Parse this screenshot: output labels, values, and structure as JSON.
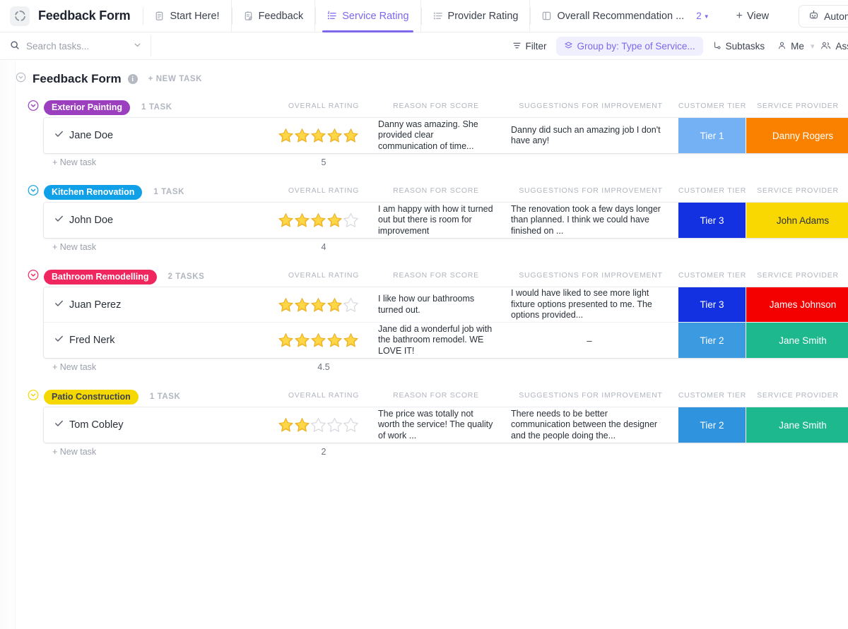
{
  "window": {
    "app_title": "Feedback Form",
    "logo_icon": "clickup-spinner-icon"
  },
  "tabs": [
    {
      "label": "Start Here!",
      "icon": "doc-icon",
      "active": false
    },
    {
      "label": "Feedback",
      "icon": "doc-edit-icon",
      "active": false
    },
    {
      "label": "Service Rating",
      "icon": "list-icon",
      "active": true
    },
    {
      "label": "Provider Rating",
      "icon": "list-icon",
      "active": false
    },
    {
      "label": "Overall Recommendation ...",
      "icon": "board-icon",
      "active": false
    }
  ],
  "tab_overflow_count": "2",
  "add_view_label": "View",
  "automate_label": "Automate",
  "search": {
    "placeholder": "Search tasks...",
    "value": "",
    "icon": "search-icon"
  },
  "toolbar": {
    "filter_label": "Filter",
    "filter_icon": "filter-icon",
    "groupby_label": "Group by: Type of Service...",
    "groupby_icon": "layers-icon",
    "subtasks_label": "Subtasks",
    "subtasks_icon": "subtask-icon",
    "me_label": "Me",
    "me_icon": "person-icon",
    "assignees_label": "Assign",
    "assignees_icon": "people-icon"
  },
  "list": {
    "title": "Feedback Form",
    "info_icon": "info-icon",
    "new_task_label": "+ NEW TASK",
    "new_task_row_label": "+ New task"
  },
  "columns": [
    {
      "key": "overall_rating",
      "label": "OVERALL RATING"
    },
    {
      "key": "reason",
      "label": "REASON FOR SCORE"
    },
    {
      "key": "suggestions",
      "label": "SUGGESTIONS FOR IMPROVEMENT"
    },
    {
      "key": "customer_tier",
      "label": "CUSTOMER TIER"
    },
    {
      "key": "service_provider",
      "label": "SERVICE PROVIDER"
    }
  ],
  "groups": [
    {
      "name": "Exterior Painting",
      "color": "#9c3fbe",
      "count_label": "1 TASK",
      "rollup_rating": "5",
      "tasks": [
        {
          "name": "Jane Doe",
          "rating": 5,
          "reason": "Danny was amazing. She provided clear communication of time...",
          "suggestions": "Danny did such an amazing job I don't have any!",
          "customer_tier": "Tier 1",
          "customer_tier_color": "#74b0f4",
          "service_provider": "Danny Rogers",
          "service_provider_color": "#fa8000"
        }
      ]
    },
    {
      "name": "Kitchen Renovation",
      "color": "#10a0e8",
      "count_label": "1 TASK",
      "rollup_rating": "4",
      "tasks": [
        {
          "name": "John Doe",
          "rating": 4,
          "reason": "I am happy with how it turned out but there is room for improvement",
          "suggestions": "The renovation took a few days longer than planned. I think we could have finished on ...",
          "customer_tier": "Tier 3",
          "customer_tier_color": "#1331e0",
          "service_provider": "John Adams",
          "service_provider_color": "#f8d800",
          "service_provider_text_color": "#2a3039"
        }
      ]
    },
    {
      "name": "Bathroom Remodelling",
      "color": "#f0275f",
      "count_label": "2 TASKS",
      "rollup_rating": "4.5",
      "tasks": [
        {
          "name": "Juan Perez",
          "rating": 4,
          "reason": "I like how our bathrooms turned out.",
          "suggestions": "I would have liked to see more light fixture options presented to me. The options provided...",
          "customer_tier": "Tier 3",
          "customer_tier_color": "#1331e0",
          "service_provider": "James Johnson",
          "service_provider_color": "#f40000"
        },
        {
          "name": "Fred Nerk",
          "rating": 5,
          "reason": "Jane did a wonderful job with the bathroom remodel. WE LOVE IT!",
          "suggestions": "–",
          "customer_tier": "Tier 2",
          "customer_tier_color": "#3c9ae0",
          "service_provider": "Jane Smith",
          "service_provider_color": "#1db88e"
        }
      ]
    },
    {
      "name": "Patio Construction",
      "color": "#f5d800",
      "text_color": "#3c4250",
      "count_label": "1 TASK",
      "rollup_rating": "2",
      "tasks": [
        {
          "name": "Tom Cobley",
          "rating": 2,
          "reason": "The price was totally not worth the service! The quality of work ...",
          "suggestions": "There needs to be better communication between the designer and the people doing the...",
          "customer_tier": "Tier 2",
          "customer_tier_color": "#2f93de",
          "service_provider": "Jane Smith",
          "service_provider_color": "#1db88e"
        }
      ]
    }
  ],
  "colors": {
    "accent": "#7b68ee",
    "star_gold": "#f5c231",
    "star_empty": "#d6d9de"
  }
}
